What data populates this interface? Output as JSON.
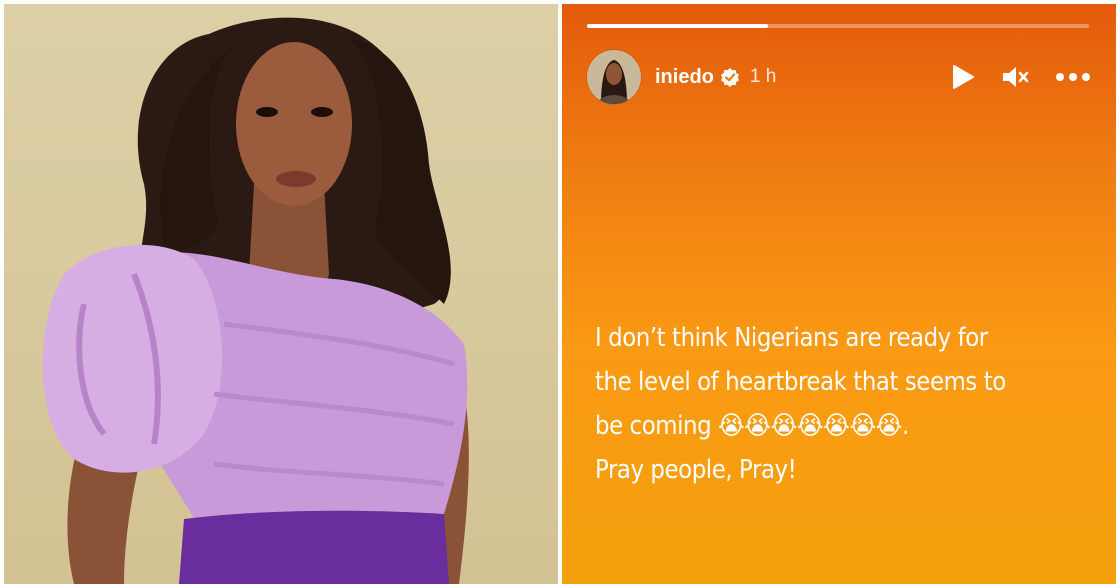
{
  "story": {
    "progress_fraction": 0.36,
    "username": "iniedo",
    "timestamp": "1 h",
    "lines": [
      "I don’t think Nigerians are ready for",
      "the level of heartbreak that seems to",
      "be coming 😭😭😭😭😭😭😭.",
      "Pray people, Pray!"
    ]
  },
  "icons": {
    "verified": "verified-badge-icon",
    "play": "play-icon",
    "mute": "mute-icon",
    "more": "more-options-icon"
  },
  "colors": {
    "story_gradient_top": "#e35a0c",
    "story_gradient_bottom": "#f2a10d",
    "photo_background": "#d8c99d",
    "blouse": "#c89ad8",
    "skirt": "#6a2d9e"
  }
}
